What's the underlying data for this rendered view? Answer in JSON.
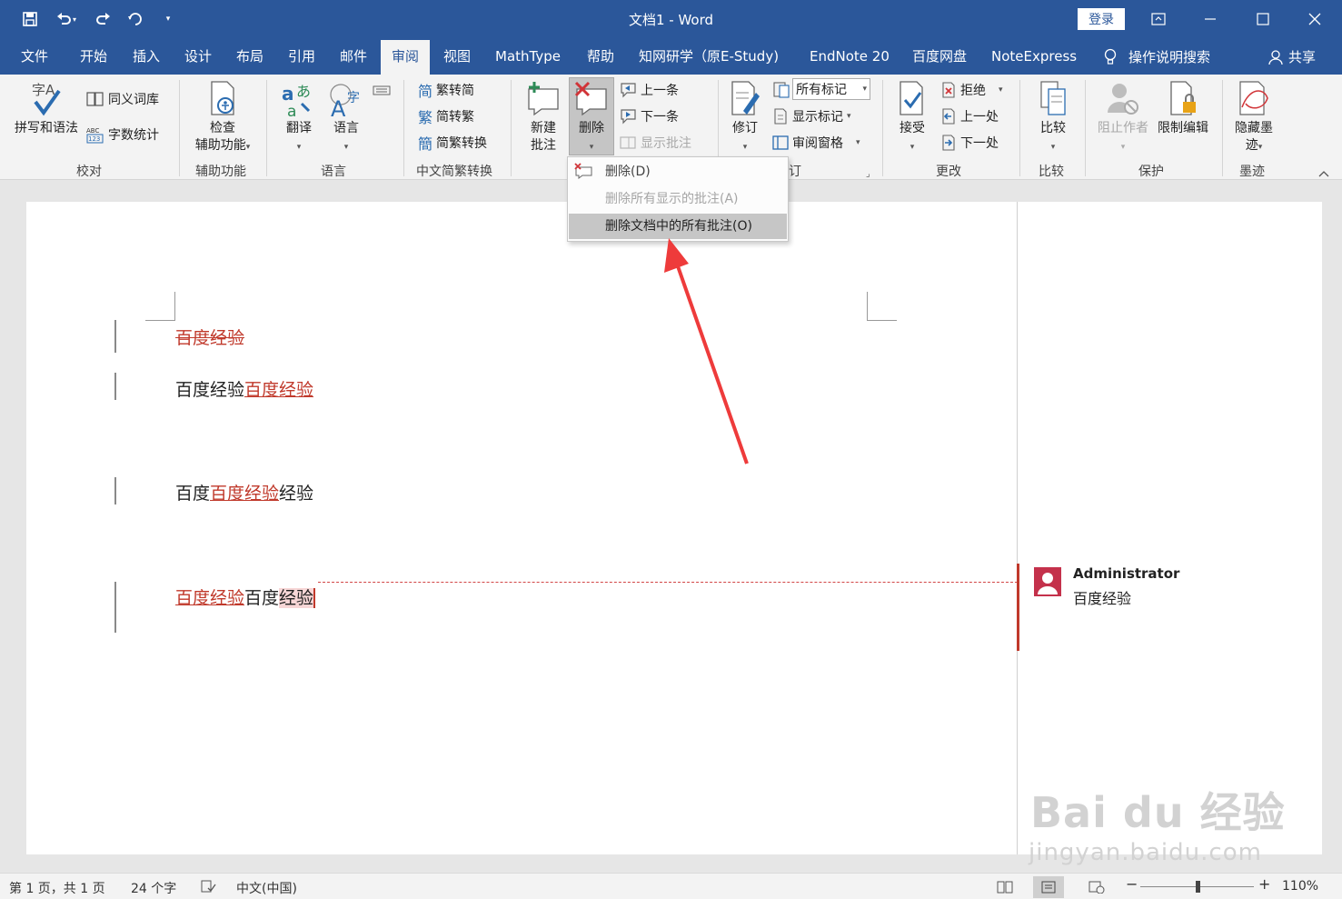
{
  "window": {
    "title": "文档1  -  Word",
    "login_label": "登录"
  },
  "tabs": [
    {
      "label": "文件"
    },
    {
      "label": "开始"
    },
    {
      "label": "插入"
    },
    {
      "label": "设计"
    },
    {
      "label": "布局"
    },
    {
      "label": "引用"
    },
    {
      "label": "邮件"
    },
    {
      "label": "审阅"
    },
    {
      "label": "视图"
    },
    {
      "label": "MathType"
    },
    {
      "label": "帮助"
    },
    {
      "label": "知网研学（原E-Study)"
    },
    {
      "label": "EndNote 20"
    },
    {
      "label": "百度网盘"
    },
    {
      "label": "NoteExpress"
    }
  ],
  "active_tab": "审阅",
  "tell_me": "操作说明搜索",
  "share": "共享",
  "ribbon": {
    "proofing": {
      "spell": "拼写和语法",
      "thesaurus": "同义词库",
      "wordcount": "字数统计",
      "label": "校对"
    },
    "accessibility": {
      "check_line1": "检查",
      "check_line2": "辅助功能",
      "label": "辅助功能"
    },
    "language": {
      "translate": "翻译",
      "language": "语言",
      "label": "语言"
    },
    "chinese": {
      "t2s": "繁转简",
      "s2t": "简转繁",
      "convert": "简繁转换",
      "label": "中文简繁转换"
    },
    "comments": {
      "new_line1": "新建",
      "new_line2": "批注",
      "delete": "删除",
      "prev": "上一条",
      "next": "下一条",
      "show": "显示批注"
    },
    "tracking": {
      "track": "修订",
      "markup_combo": "所有标记",
      "show_markup": "显示标记",
      "review_pane": "审阅窗格",
      "label": "订"
    },
    "changes": {
      "accept": "接受",
      "reject": "拒绝",
      "prev": "上一处",
      "next": "下一处",
      "label": "更改"
    },
    "compare": {
      "compare": "比较",
      "label": "比较"
    },
    "protect": {
      "block": "阻止作者",
      "restrict": "限制编辑",
      "label": "保护"
    },
    "ink": {
      "hide_line1": "隐藏墨",
      "hide_line2": "迹",
      "label": "墨迹"
    }
  },
  "delete_menu": {
    "items": [
      {
        "label": "删除(D)",
        "enabled": true
      },
      {
        "label": "删除所有显示的批注(A)",
        "enabled": false
      },
      {
        "label": "删除文档中的所有批注(O)",
        "enabled": true
      }
    ]
  },
  "document": {
    "line1_deleted": "百度经验",
    "line2_plain": "百度经验",
    "line2_inserted": "百度经验",
    "line3_a": "百度",
    "line3_inserted": "百度经验",
    "line3_b": "经验",
    "line4_inserted": "百度经验",
    "line4_plain": "百度",
    "line4_commented": "经验"
  },
  "comment": {
    "author": "Administrator",
    "text": "百度经验"
  },
  "watermark": {
    "line1": "Bai du 经验",
    "line2": "jingyan.baidu.com"
  },
  "status": {
    "page": "第 1 页，共 1 页",
    "words": "24 个字",
    "language": "中文(中国)",
    "zoom": "110%"
  },
  "colors": {
    "titlebar": "#2b579a",
    "revision": "#c0392b",
    "comment_avatar": "#c4314b"
  }
}
